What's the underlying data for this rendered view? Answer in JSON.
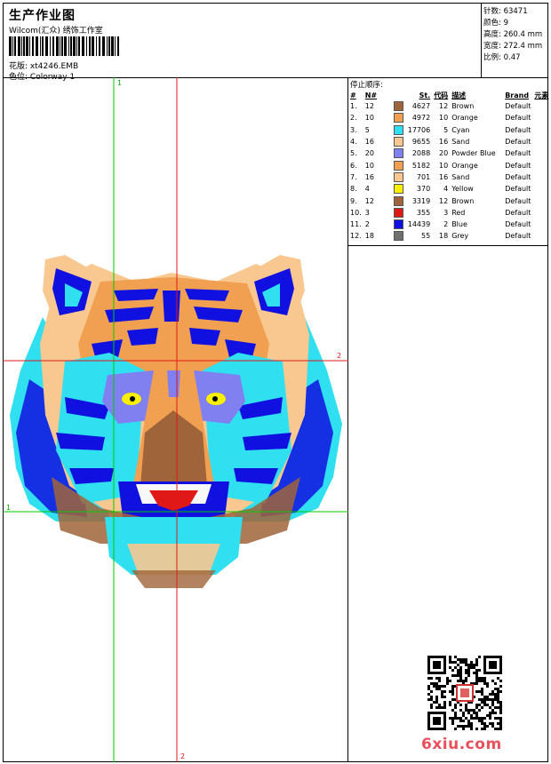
{
  "header": {
    "title": "生产作业图",
    "company": "Wilcom(汇众) 绣饰工作室",
    "file_label": "花版:",
    "file_value": "xt4246.EMB",
    "colorway_label": "色位:",
    "colorway_value": "Colorway 1"
  },
  "stats": [
    {
      "label": "针数:",
      "value": "63471"
    },
    {
      "label": "颜色:",
      "value": "9"
    },
    {
      "label": "高度:",
      "value": "260.4 mm"
    },
    {
      "label": "宽度:",
      "value": "272.4 mm"
    },
    {
      "label": "比例:",
      "value": "0.47"
    }
  ],
  "sequence": {
    "title": "停止顺序:",
    "headers": [
      "#",
      "N#",
      "St.",
      "代码",
      "描述",
      "Brand",
      "元素"
    ],
    "rows": [
      {
        "idx": "1.",
        "n": "12",
        "color": "#a0643a",
        "st": "4627",
        "code": "12",
        "desc": "Brown",
        "brand": "Default"
      },
      {
        "idx": "2.",
        "n": "10",
        "color": "#f0a050",
        "st": "4972",
        "code": "10",
        "desc": "Orange",
        "brand": "Default"
      },
      {
        "idx": "3.",
        "n": "5",
        "color": "#30e0f0",
        "st": "17706",
        "code": "5",
        "desc": "Cyan",
        "brand": "Default"
      },
      {
        "idx": "4.",
        "n": "16",
        "color": "#f8c890",
        "st": "9655",
        "code": "16",
        "desc": "Sand",
        "brand": "Default"
      },
      {
        "idx": "5.",
        "n": "20",
        "color": "#8080f0",
        "st": "2088",
        "code": "20",
        "desc": "Powder Blue",
        "brand": "Default"
      },
      {
        "idx": "6.",
        "n": "10",
        "color": "#f0a050",
        "st": "5182",
        "code": "10",
        "desc": "Orange",
        "brand": "Default"
      },
      {
        "idx": "7.",
        "n": "16",
        "color": "#f8c890",
        "st": "701",
        "code": "16",
        "desc": "Sand",
        "brand": "Default"
      },
      {
        "idx": "8.",
        "n": "4",
        "color": "#f8f000",
        "st": "370",
        "code": "4",
        "desc": "Yellow",
        "brand": "Default"
      },
      {
        "idx": "9.",
        "n": "12",
        "color": "#a0643a",
        "st": "3319",
        "code": "12",
        "desc": "Brown",
        "brand": "Default"
      },
      {
        "idx": "10.",
        "n": "3",
        "color": "#e01818",
        "st": "355",
        "code": "3",
        "desc": "Red",
        "brand": "Default"
      },
      {
        "idx": "11.",
        "n": "2",
        "color": "#1010e0",
        "st": "14439",
        "code": "2",
        "desc": "Blue",
        "brand": "Default"
      },
      {
        "idx": "12.",
        "n": "18",
        "color": "#707070",
        "st": "55",
        "code": "18",
        "desc": "Grey",
        "brand": "Default"
      }
    ]
  },
  "guides": {
    "green_label_1": "1",
    "green_label_2": "1",
    "red_label_1": "2",
    "red_label_2": "2"
  },
  "watermark": "6xiu.com"
}
